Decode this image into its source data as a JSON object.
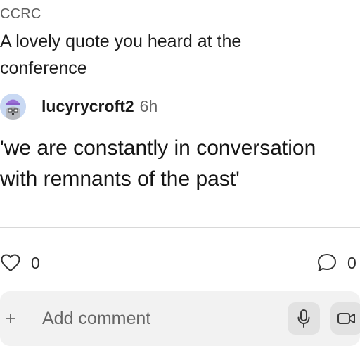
{
  "post": {
    "community": "CCRC",
    "prompt": "A lovely quote you heard at the conference",
    "author": "lucyrycroft2",
    "time": "6h",
    "body_line1": "'we are constantly in conversation",
    "body_line2": "with remnants of the past'"
  },
  "actions": {
    "like_count": "0",
    "comment_count": "0"
  },
  "composer": {
    "plus_label": "+",
    "placeholder": "Add comment"
  },
  "icons": {
    "like": "heart-icon",
    "comment": "speech-bubble-icon",
    "mic": "microphone-icon",
    "video": "video-camera-icon"
  },
  "colors": {
    "avatar_background": "#c9d9f3",
    "composer_background": "#f2f2f2",
    "icon_button_background": "#e2e2e2"
  }
}
